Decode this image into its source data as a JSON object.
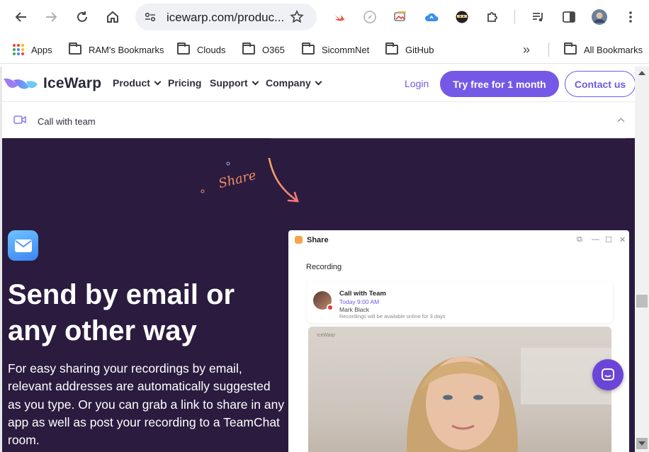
{
  "browser": {
    "url": "icewarp.com/produc...",
    "bookmarks": [
      "Apps",
      "RAM's Bookmarks",
      "Clouds",
      "O365",
      "SicommNet",
      "GitHub"
    ],
    "all_bookmarks": "All Bookmarks",
    "overflow": "»"
  },
  "site": {
    "brand": "IceWarp",
    "nav": [
      "Product",
      "Pricing",
      "Support",
      "Company"
    ],
    "login": "Login",
    "try_free": "Try free for 1 month",
    "contact": "Contact us"
  },
  "subbar": {
    "label": "Call with team"
  },
  "hero": {
    "doodle": "Share",
    "title": "Send by email or any other way",
    "body": "For easy sharing your recordings by email, relevant addresses are automatically suggested as you type. Or you can grab a link to share in any app as well as post your recording to a TeamChat room."
  },
  "share_window": {
    "title": "Share",
    "section": "Recording",
    "card": {
      "title": "Call with Team",
      "time": "Today 9:00 AM",
      "name": "Mark Black",
      "note": "Recordings will be available online for 3 days"
    },
    "video_watermark": "IceWarp"
  },
  "colors": {
    "accent": "#7559e6",
    "hero_bg": "#2b1b3f",
    "doodle": "#f08f62"
  }
}
